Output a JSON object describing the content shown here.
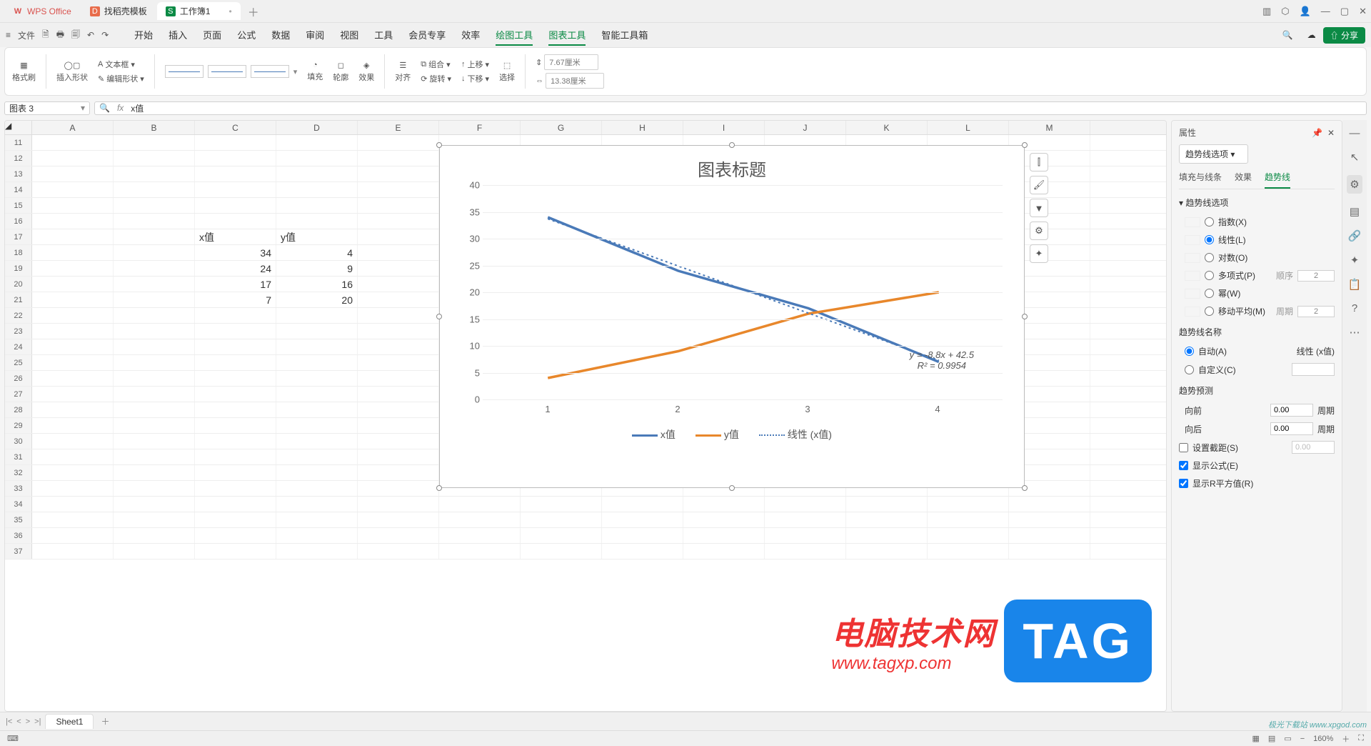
{
  "titlebar": {
    "tabs": [
      {
        "icon": "W",
        "label": "WPS Office"
      },
      {
        "icon": "D",
        "label": "找稻壳模板"
      },
      {
        "icon": "S",
        "label": "工作簿1"
      }
    ]
  },
  "menu": {
    "file": "文件",
    "items": [
      "开始",
      "插入",
      "页面",
      "公式",
      "数据",
      "审阅",
      "视图",
      "工具",
      "会员专享",
      "效率",
      "绘图工具",
      "图表工具",
      "智能工具箱"
    ],
    "active": [
      "绘图工具",
      "图表工具"
    ],
    "share": "分享"
  },
  "ribbon": {
    "format_painter": "格式刷",
    "insert_shape": "插入形状",
    "text_box": "文本框",
    "edit_shape": "编辑形状",
    "fill": "填充",
    "outline": "轮廓",
    "effect": "效果",
    "align": "对齐",
    "group": "组合",
    "rotate": "旋转",
    "up": "上移",
    "down": "下移",
    "select": "选择",
    "w": "7.67厘米",
    "h": "13.38厘米"
  },
  "namebox": "图表 3",
  "formula": "x值",
  "cols": [
    "A",
    "B",
    "C",
    "D",
    "E",
    "F",
    "G",
    "H",
    "I",
    "J",
    "K",
    "L",
    "M"
  ],
  "rows_start": 11,
  "rows_end": 37,
  "cells": {
    "C17": "x值",
    "D17": "y值",
    "C18": "34",
    "D18": "4",
    "C19": "24",
    "D19": "9",
    "C20": "17",
    "D20": "16",
    "C21": "7",
    "D21": "20"
  },
  "chart_data": {
    "type": "line",
    "title": "图表标题",
    "categories": [
      1,
      2,
      3,
      4
    ],
    "series": [
      {
        "name": "x值",
        "values": [
          34,
          24,
          17,
          7
        ],
        "color": "#4a7ab8"
      },
      {
        "name": "y值",
        "values": [
          4,
          9,
          16,
          20
        ],
        "color": "#e8872b"
      },
      {
        "name": "线性 (x值)",
        "values": [
          33.7,
          24.9,
          16.1,
          7.3
        ],
        "color": "#4a7ab8",
        "style": "dotted"
      }
    ],
    "ylim": [
      0,
      40
    ],
    "ystep": 5,
    "equation": "y = -8.8x + 42.5",
    "r2": "R² = 0.9954"
  },
  "panel": {
    "title": "属性",
    "selector": "趋势线选项",
    "tabs": [
      "填充与线条",
      "效果",
      "趋势线"
    ],
    "active_tab": "趋势线",
    "section_options": "趋势线选项",
    "opts": {
      "exp": "指数(X)",
      "lin": "线性(L)",
      "log": "对数(O)",
      "poly": "多项式(P)",
      "poly_order_label": "顺序",
      "poly_order": "2",
      "pow": "幂(W)",
      "ma": "移动平均(M)",
      "ma_period_label": "周期",
      "ma_period": "2"
    },
    "name_section": "趋势线名称",
    "auto": "自动(A)",
    "auto_val": "线性 (x值)",
    "custom": "自定义(C)",
    "forecast_section": "趋势预测",
    "forward": "向前",
    "forward_val": "0.00",
    "period": "周期",
    "backward": "向后",
    "backward_val": "0.00",
    "intercept": "设置截距(S)",
    "intercept_val": "0.00",
    "show_eq": "显示公式(E)",
    "show_r2": "显示R平方值(R)"
  },
  "sheet_tab": "Sheet1",
  "status": {
    "zoom": "160%"
  },
  "watermark": {
    "t1": "电脑技术网",
    "url": "www.tagxp.com",
    "tag": "TAG",
    "corner": "极光下载站  www.xpgod.com"
  }
}
